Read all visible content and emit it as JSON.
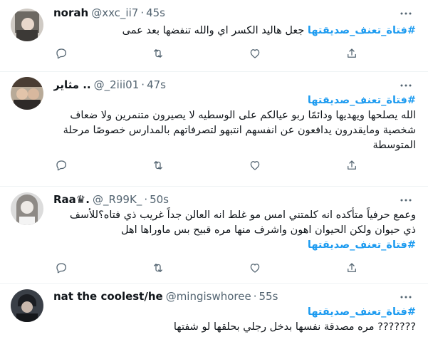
{
  "tweets": [
    {
      "display_name": "norah",
      "handle": "@xxc_ii7",
      "time": "45s",
      "hashtag": "#فتاة_تعنف_صديقتها",
      "lines": [
        "جعل هاليد الكسر اي والله تنفضها بعد عمى"
      ]
    },
    {
      "display_name": "مثاير ..",
      "handle": "@_2iii01",
      "time": "47s",
      "hashtag": "#فتاة_تعنف_صديقتها",
      "lines": [
        "الله يصلحها ويهديها ودائمًا ربو عيالكم على الوسطيه لا يصيرون متنمرين ولا ضعاف",
        "شخصية ومايقدرون يدافعون عن انفسهم انتبهو لتصرفاتهم بالمدارس خصوصًا مرحلة",
        "المتوسطة"
      ]
    },
    {
      "display_name": "Raa♛.",
      "handle": "@_R99K_",
      "time": "50s",
      "hashtag": "#فتاة_تعنف_صديقتها",
      "lines": [
        "وعمع حرفياً متأكده انه كلمتني امس مو غلط انه العالن جداً غريب ذي فتاه؟للأسف",
        "ذي حيوان ولكن الحيوان اهون واشرف منها مره قبيح بس ماوراها اهل"
      ]
    },
    {
      "display_name": "nat the coolest/he",
      "handle": "@mingiswhoree",
      "time": "55s",
      "hashtag": "#فتاة_تعنف_صديقتها",
      "lines": [
        "??????? مره مصدقة نفسها بدخل رجلي بحلقها لو شفتها"
      ]
    }
  ],
  "icons": {
    "reply": "reply-icon",
    "retweet": "retweet-icon",
    "like": "like-icon",
    "share": "share-icon",
    "more": "more-icon"
  },
  "colors": {
    "hashtag": "#1d9bf0",
    "secondary_text": "#536471",
    "divider": "#eff3f4"
  }
}
